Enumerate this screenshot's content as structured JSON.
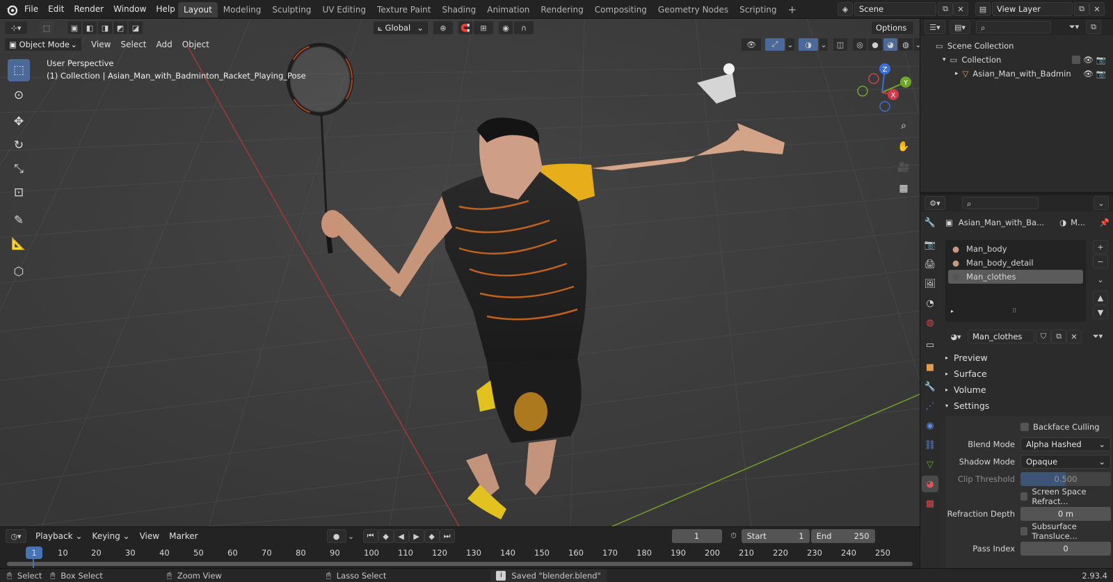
{
  "app": {
    "menu": [
      "File",
      "Edit",
      "Render",
      "Window",
      "Help"
    ],
    "workspaces": [
      "Layout",
      "Modeling",
      "Sculpting",
      "UV Editing",
      "Texture Paint",
      "Shading",
      "Animation",
      "Rendering",
      "Compositing",
      "Geometry Nodes",
      "Scripting"
    ],
    "active_workspace": "Layout",
    "scene": "Scene",
    "view_layer": "View Layer"
  },
  "viewport": {
    "mode": "Object Mode",
    "menus": [
      "View",
      "Select",
      "Add",
      "Object"
    ],
    "transform_orientation": "Global",
    "options_label": "Options",
    "overlay_title": "User Perspective",
    "overlay_subtitle": "(1) Collection | Asian_Man_with_Badminton_Racket_Playing_Pose",
    "gizmo_axes": {
      "z": "Z",
      "y": "Y",
      "x": "X"
    }
  },
  "outliner": {
    "root": "Scene Collection",
    "collection": "Collection",
    "object": "Asian_Man_with_Badmin"
  },
  "properties": {
    "object_name": "Asian_Man_with_Ba...",
    "material_short": "M...",
    "material_slots": [
      "Man_body",
      "Man_body_detail",
      "Man_clothes"
    ],
    "active_slot": "Man_clothes",
    "material_name": "Man_clothes",
    "panels": [
      "Preview",
      "Surface",
      "Volume",
      "Settings"
    ],
    "settings": {
      "backface_culling": "Backface Culling",
      "blend_mode_label": "Blend Mode",
      "blend_mode": "Alpha Hashed",
      "shadow_mode_label": "Shadow Mode",
      "shadow_mode": "Opaque",
      "clip_threshold_label": "Clip Threshold",
      "clip_threshold": "0.500",
      "ssr": "Screen Space Refract...",
      "refraction_depth_label": "Refraction Depth",
      "refraction_depth": "0 m",
      "sss": "Subsurface Transluce...",
      "pass_index_label": "Pass Index",
      "pass_index": "0"
    }
  },
  "timeline": {
    "menus": [
      "Playback",
      "Keying",
      "View",
      "Marker"
    ],
    "current_frame": "1",
    "start_label": "Start",
    "start": "1",
    "end_label": "End",
    "end": "250",
    "ruler": [
      "1",
      "10",
      "20",
      "30",
      "40",
      "50",
      "60",
      "70",
      "80",
      "90",
      "100",
      "110",
      "120",
      "130",
      "140",
      "150",
      "160",
      "170",
      "180",
      "190",
      "200",
      "210",
      "220",
      "230",
      "240",
      "250"
    ]
  },
  "statusbar": {
    "select": "Select",
    "box_select": "Box Select",
    "zoom_view": "Zoom View",
    "lasso_select": "Lasso Select",
    "message": "Saved \"blender.blend\"",
    "version": "2.93.4"
  }
}
